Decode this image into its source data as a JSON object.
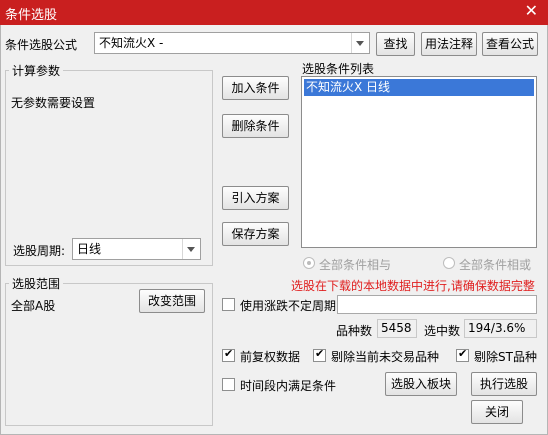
{
  "window": {
    "title": "条件选股",
    "close_glyph": "✕"
  },
  "formula": {
    "label": "条件选股公式",
    "value": "不知流火X  -",
    "find_button": "查找",
    "usage_button": "用法注释",
    "view_button": "查看公式"
  },
  "calc_params": {
    "legend": "计算参数",
    "message": "无参数需要设置",
    "period_label": "选股周期:",
    "period_value": "日线"
  },
  "buttons": {
    "add_condition": "加入条件",
    "delete_condition": "删除条件",
    "import_scheme": "引入方案",
    "save_scheme": "保存方案",
    "select_to_block": "选股入板块",
    "execute": "执行选股",
    "close": "关闭",
    "change_range": "改变范围"
  },
  "condition_list": {
    "label": "选股条件列表",
    "items": [
      "不知流火X  日线"
    ]
  },
  "logic": {
    "and_label": "全部条件相与",
    "or_label": "全部条件相或"
  },
  "warning": {
    "text": "选股在下载的本地数据中进行,请确保数据完整",
    "color": "#e02020"
  },
  "range": {
    "legend": "选股范围",
    "value": "全部A股"
  },
  "options": {
    "uncertain_period": "使用涨跌不定周期",
    "pre_adjust": "前复权数据",
    "exclude_untraded": "剔除当前未交易品种",
    "exclude_st": "剔除ST品种",
    "time_period": "时间段内满足条件"
  },
  "stats": {
    "count_label": "品种数",
    "count_value": "5458",
    "selected_label": "选中数",
    "selected_value": "194/3.6%"
  },
  "colors": {
    "titlebar": "#c91f1f",
    "selection": "#3b78d8"
  }
}
